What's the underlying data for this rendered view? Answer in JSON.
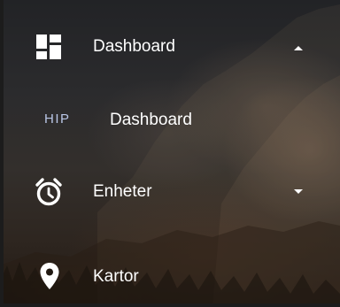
{
  "menu": {
    "dashboard": {
      "label": "Dashboard",
      "icon": "dashboard-icon",
      "expanded": true
    },
    "sub_dashboard": {
      "prefix": "HIP",
      "label": "Dashboard"
    },
    "enheter": {
      "label": "Enheter",
      "icon": "alarm-clock-icon",
      "expanded": false
    },
    "kartor": {
      "label": "Kartor",
      "icon": "map-pin-icon"
    }
  },
  "colors": {
    "text": "#ffffff",
    "hip_prefix": "#b9c6e6",
    "icon": "#ffffff"
  }
}
